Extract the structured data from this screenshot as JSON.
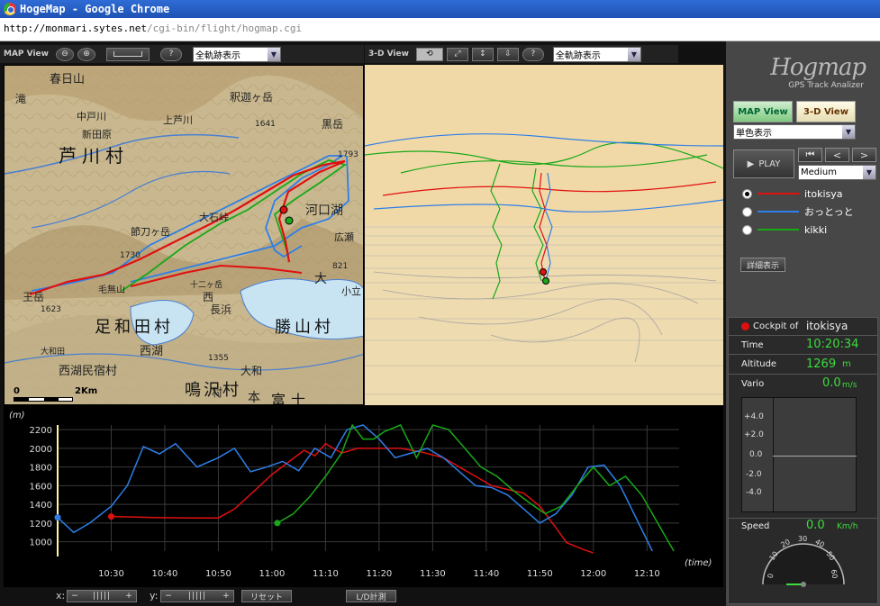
{
  "window": {
    "title": "HogeMap - Google Chrome",
    "url_host": "http://monmari.sytes.net",
    "url_path": "/cgi-bin/flight/hogmap.cgi"
  },
  "map_view": {
    "label": "MAP View",
    "zoom_out": "⊖",
    "zoom_in": "⊕",
    "help": "?",
    "track_select": "全軌跡表示",
    "scale_label": "2Km",
    "scale_zero": "0",
    "places": [
      "春日山",
      "中戸川",
      "新田原",
      "芦川村",
      "上芦川",
      "釈迦ヶ岳",
      "1641",
      "黒岳",
      "1793",
      "節刀ヶ岳",
      "大石峠",
      "1730",
      "河口湖",
      "王岳",
      "1623",
      "毛無山",
      "足和田村",
      "勝山村",
      "西湖",
      "西湖民宿村",
      "長浜",
      "十二ヶ岳",
      "1355",
      "鳴沢村",
      "大和",
      "小立",
      "広瀬",
      "富士",
      "村",
      "821",
      "大",
      "西",
      "本",
      "滝",
      "大和田"
    ]
  },
  "view3d": {
    "label": "3-D View",
    "help": "?",
    "track_select": "全軌跡表示"
  },
  "graph": {
    "y_unit": "(m)",
    "x_unit": "(time)",
    "y_ticks": [
      "2200",
      "2000",
      "1800",
      "1600",
      "1400",
      "1200",
      "1000"
    ],
    "x_ticks": [
      "10:30",
      "10:40",
      "10:50",
      "11:00",
      "11:10",
      "11:20",
      "11:30",
      "11:40",
      "11:50",
      "12:00",
      "12:10"
    ]
  },
  "chart_data": {
    "type": "line",
    "title": "",
    "xlabel": "(time)",
    "ylabel": "(m)",
    "ylim": [
      900,
      2250
    ],
    "xlim": [
      "10:20",
      "12:16"
    ],
    "series": [
      {
        "name": "itokisya",
        "color": "#e01010",
        "x": [
          "10:30",
          "10:38",
          "10:45",
          "10:50",
          "10:53",
          "10:57",
          "11:00",
          "11:03",
          "11:06",
          "11:08",
          "11:10",
          "11:13",
          "11:16",
          "11:20",
          "11:24",
          "11:28",
          "11:32",
          "11:35",
          "11:38",
          "11:41",
          "11:44",
          "11:47",
          "11:50",
          "11:53",
          "11:55",
          "11:58",
          "12:00"
        ],
        "y": [
          1270,
          1260,
          1255,
          1255,
          1350,
          1560,
          1720,
          1850,
          1980,
          1920,
          2050,
          1950,
          2000,
          2000,
          2000,
          1960,
          1900,
          1800,
          1700,
          1600,
          1560,
          1520,
          1380,
          1150,
          990,
          920,
          880
        ]
      },
      {
        "name": "おっとっと",
        "color": "#2e7fe8",
        "x": [
          "10:20",
          "10:23",
          "10:26",
          "10:30",
          "10:33",
          "10:36",
          "10:39",
          "10:42",
          "10:46",
          "10:50",
          "10:53",
          "10:56",
          "10:59",
          "11:02",
          "11:05",
          "11:08",
          "11:11",
          "11:14",
          "11:17",
          "11:20",
          "11:23",
          "11:26",
          "11:29",
          "11:32",
          "11:35",
          "11:38",
          "11:41",
          "11:44",
          "11:47",
          "11:50",
          "11:53",
          "11:56",
          "11:59",
          "12:02",
          "12:05",
          "12:08",
          "12:11"
        ],
        "y": [
          1260,
          1100,
          1200,
          1380,
          1600,
          2020,
          1940,
          2050,
          1800,
          1900,
          2000,
          1750,
          1800,
          1860,
          1760,
          2000,
          1900,
          2200,
          2250,
          2100,
          1900,
          1950,
          2000,
          1900,
          1750,
          1600,
          1580,
          1500,
          1350,
          1200,
          1300,
          1500,
          1800,
          1820,
          1600,
          1250,
          900
        ]
      },
      {
        "name": "kikki",
        "color": "#18a818",
        "x": [
          "11:01",
          "11:04",
          "11:07",
          "11:10",
          "11:13",
          "11:15",
          "11:17",
          "11:19",
          "11:21",
          "11:24",
          "11:27",
          "11:30",
          "11:33",
          "11:36",
          "11:39",
          "11:42",
          "11:45",
          "11:48",
          "11:51",
          "11:54",
          "11:57",
          "12:00",
          "12:03",
          "12:06",
          "12:09",
          "12:12",
          "12:15"
        ],
        "y": [
          1200,
          1300,
          1480,
          1700,
          1950,
          2250,
          2100,
          2100,
          2180,
          2250,
          1900,
          2250,
          2200,
          2000,
          1800,
          1700,
          1550,
          1420,
          1300,
          1380,
          1600,
          1800,
          1600,
          1700,
          1500,
          1200,
          900
        ]
      }
    ],
    "markers": [
      {
        "series": "おっとっと",
        "x": "10:20",
        "y": 1260
      },
      {
        "series": "itokisya",
        "x": "10:30",
        "y": 1270
      },
      {
        "series": "kikki",
        "x": "11:01",
        "y": 1200
      }
    ]
  },
  "bottom": {
    "x_label": "x:",
    "y_label": "y:",
    "minus": "−",
    "plus": "+",
    "reset": "リセット",
    "ld": "L/D計測"
  },
  "right": {
    "logo": "Hogmap",
    "logo_sub": "GPS Track Analizer",
    "tab_map": "MAP View",
    "tab_3d": "3-D View",
    "color_select": "単色表示",
    "play": "PLAY",
    "speed_select": "Medium",
    "pilots": [
      {
        "name": "itokisya",
        "color": "#e01010",
        "selected": true
      },
      {
        "name": "おっとっと",
        "color": "#2e7fe8",
        "selected": false
      },
      {
        "name": "kikki",
        "color": "#18a818",
        "selected": false
      }
    ],
    "detail": "詳細表示"
  },
  "cockpit": {
    "label": "Cockpit of",
    "pilot": "itokisya",
    "time_label": "Time",
    "time": "10:20:34",
    "alt_label": "Altitude",
    "alt": "1269",
    "alt_unit": "m",
    "vario_label": "Vario",
    "vario": "0.0",
    "vario_unit": "m/s",
    "vario_ticks": [
      "+4.0",
      "+2.0",
      "0.0",
      "-2.0",
      "-4.0"
    ],
    "speed_label": "Speed",
    "speed": "0.0",
    "speed_unit": "Km/h",
    "gauge_ticks": [
      "0",
      "10",
      "20",
      "30",
      "40",
      "50",
      "60"
    ]
  }
}
